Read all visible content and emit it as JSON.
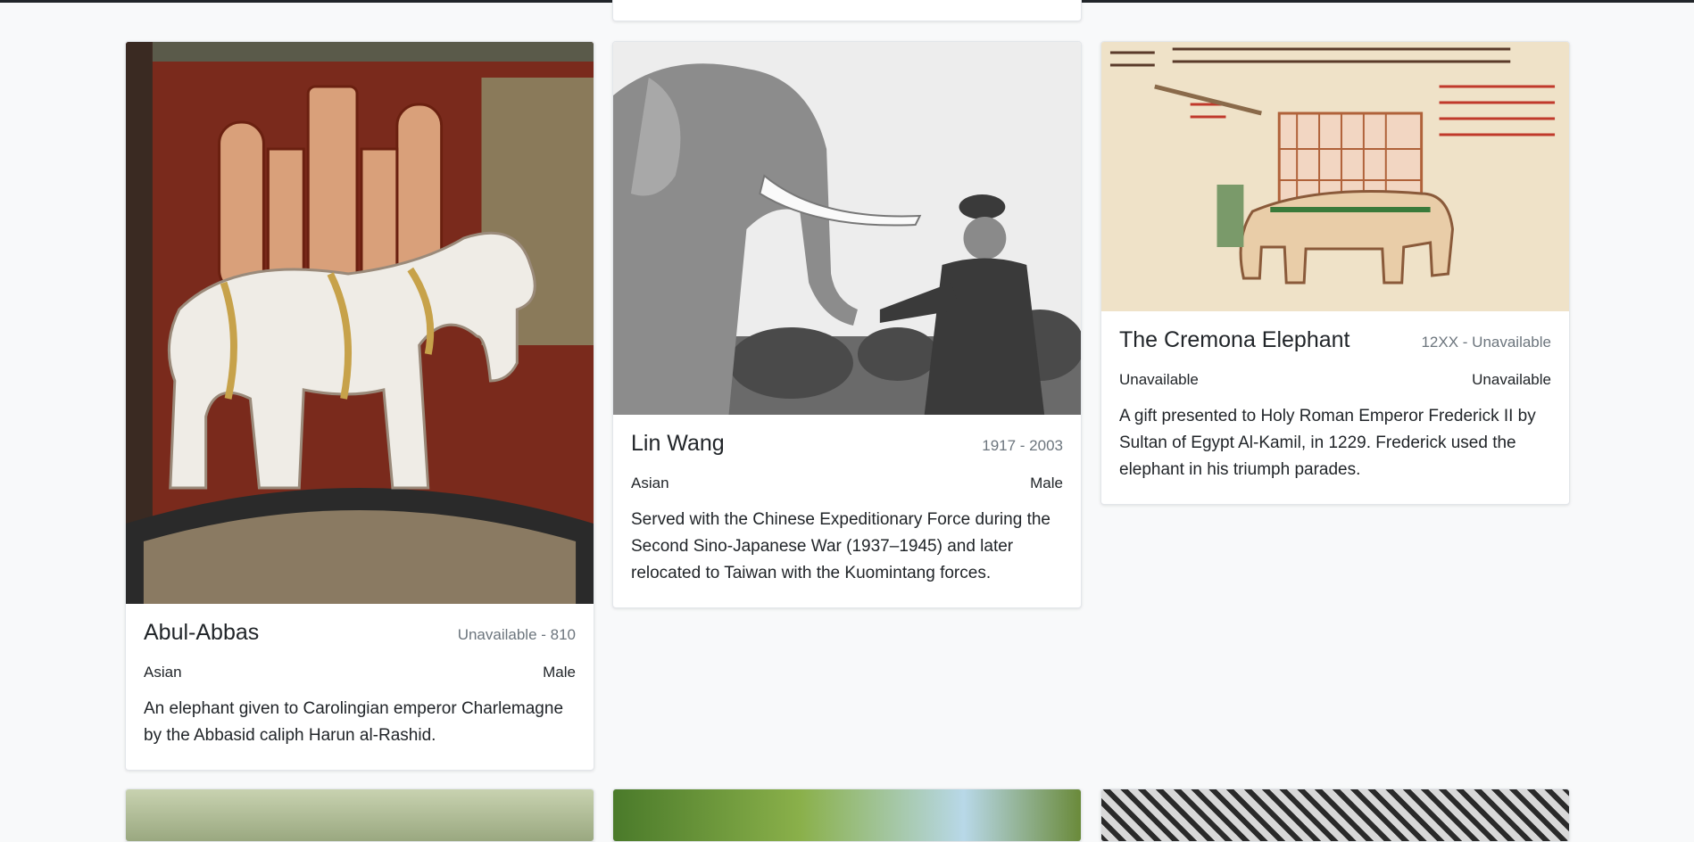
{
  "cards": [
    {
      "name": "Abul-Abbas",
      "dates": "Unavailable - 810",
      "species": "Asian",
      "sex": "Male",
      "description": "An elephant given to Carolingian emperor Charlemagne by the Abbasid caliph Harun al-Rashid.",
      "image_icon": "fresco-elephant-image"
    },
    {
      "name": "Lin Wang",
      "dates": "1917 - 2003",
      "species": "Asian",
      "sex": "Male",
      "description": "Served with the Chinese Expeditionary Force during the Second Sino-Japanese War (1937–1945) and later relocated to Taiwan with the Kuomintang forces.",
      "image_icon": "photo-elephant-soldier-image"
    },
    {
      "name": "The Cremona Elephant",
      "dates": "12XX - Unavailable",
      "species": "Unavailable",
      "sex": "Unavailable",
      "description": "A gift presented to Holy Roman Emperor Frederick II by Sultan of Egypt Al-Kamil, in 1229. Frederick used the elephant in his triumph parades.",
      "image_icon": "manuscript-elephant-image"
    }
  ],
  "colors": {
    "page_bg": "#f8f9fa",
    "card_bg": "#ffffff",
    "muted_text": "#6c757d",
    "body_text": "#212529"
  }
}
